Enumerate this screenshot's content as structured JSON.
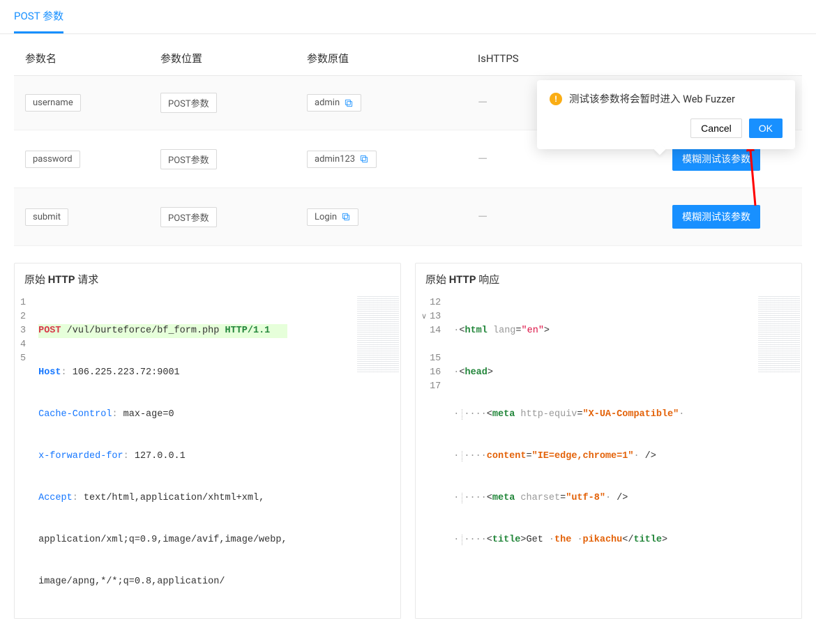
{
  "tab": {
    "title": "POST 参数"
  },
  "table": {
    "headers": {
      "name": "参数名",
      "pos": "参数位置",
      "val": "参数原值",
      "https": "IsHTTPS"
    },
    "rows": [
      {
        "name": "username",
        "pos": "POST参数",
        "val": "admin",
        "action": "模糊测试该参数"
      },
      {
        "name": "password",
        "pos": "POST参数",
        "val": "admin123",
        "action": "模糊测试该参数"
      },
      {
        "name": "submit",
        "pos": "POST参数",
        "val": "Login",
        "action": "模糊测试该参数"
      }
    ],
    "dash": "—"
  },
  "popover": {
    "message": "测试该参数将会暂时进入 Web Fuzzer",
    "cancel": "Cancel",
    "ok": "OK"
  },
  "request": {
    "title_prefix": "原始 ",
    "title_bold": "HTTP",
    "title_suffix": " 请求",
    "lines": {
      "l1_method": "POST",
      "l1_path": " /vul/burteforce/bf_form.php ",
      "l1_proto": "HTTP/1.1",
      "l2_k": "Host",
      "l2_sep": ": ",
      "l2_v": "106.225.223.72:9001",
      "l3_k": "Cache-Control",
      "l3_sep": ": ",
      "l3_v": "max-age=0",
      "l4_k": "x-forwarded-for",
      "l4_sep": ": ",
      "l4_v": "127.0.0.1",
      "l5_k": "Accept",
      "l5_sep": ": ",
      "l5_v": "text/html,application/xhtml+xml,",
      "l6": "application/xml;q=0.9,image/avif,image/webp,",
      "l7": "image/apng,*/*;q=0.8,application/"
    },
    "gutter": [
      "1",
      "2",
      "3",
      "4",
      "5"
    ]
  },
  "response": {
    "title_prefix": "原始 ",
    "title_bold": "HTTP",
    "title_suffix": " 响应",
    "lines": {
      "l12_a": "<",
      "l12_tag": "html",
      "l12_attr": " lang",
      "l12_eq": "=",
      "l12_val": "\"en\"",
      "l12_b": ">",
      "l13_a": "<",
      "l13_tag": "head",
      "l13_b": ">",
      "l14_ind": "····",
      "l14_a": "<",
      "l14_tag": "meta",
      "l14_attr1": " http-equiv",
      "l14_eq": "=",
      "l14_val1": "\"X-UA-Compatible\"",
      "l14b_attr": "content",
      "l14b_val": "\"IE=edge,chrome=1\"",
      "l14b_end": " />",
      "l15_a": "<",
      "l15_tag": "meta",
      "l15_attr": " charset",
      "l15_val": "\"utf-8\"",
      "l15_end": " />",
      "l16_a": "<",
      "l16_tag": "title",
      "l16_b": ">",
      "l16_t1": "Get ",
      "l16_t2": "the ",
      "l16_t3": "pikachu",
      "l16_c": "</",
      "l16_tag2": "title",
      "l16_d": ">"
    },
    "gutter": [
      "12",
      "13",
      "14",
      "",
      "15",
      "16",
      "17"
    ]
  }
}
